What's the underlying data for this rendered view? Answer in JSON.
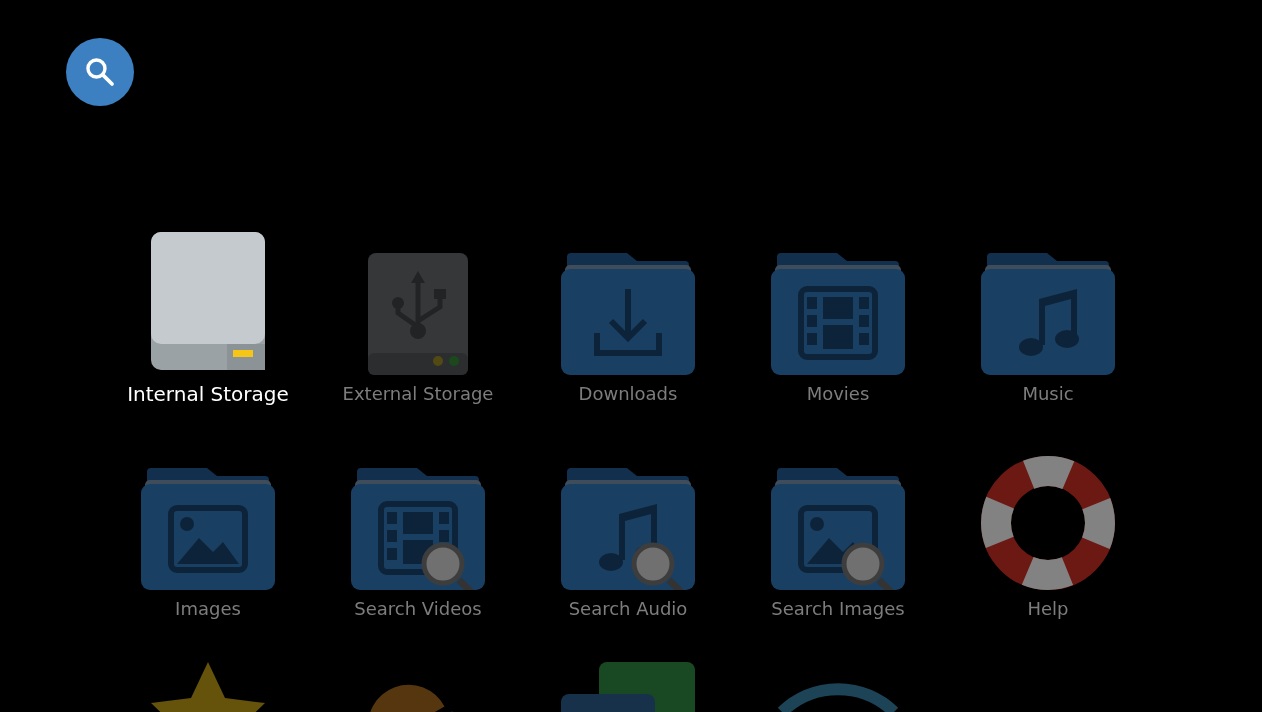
{
  "items": [
    {
      "kind": "internal-drive",
      "label": "Internal Storage",
      "selected": true
    },
    {
      "kind": "usb-drive",
      "label": "External Storage",
      "selected": false
    },
    {
      "kind": "folder-download",
      "label": "Downloads",
      "selected": false
    },
    {
      "kind": "folder-film",
      "label": "Movies",
      "selected": false
    },
    {
      "kind": "folder-music",
      "label": "Music",
      "selected": false
    },
    {
      "kind": "folder-image",
      "label": "Images",
      "selected": false
    },
    {
      "kind": "search-film",
      "label": "Search Videos",
      "selected": false
    },
    {
      "kind": "search-music",
      "label": "Search Audio",
      "selected": false
    },
    {
      "kind": "search-image",
      "label": "Search Images",
      "selected": false
    },
    {
      "kind": "help",
      "label": "Help",
      "selected": false
    },
    {
      "kind": "star",
      "selected": false
    },
    {
      "kind": "pie",
      "selected": false
    },
    {
      "kind": "apps",
      "selected": false
    },
    {
      "kind": "wifi",
      "selected": false
    }
  ]
}
